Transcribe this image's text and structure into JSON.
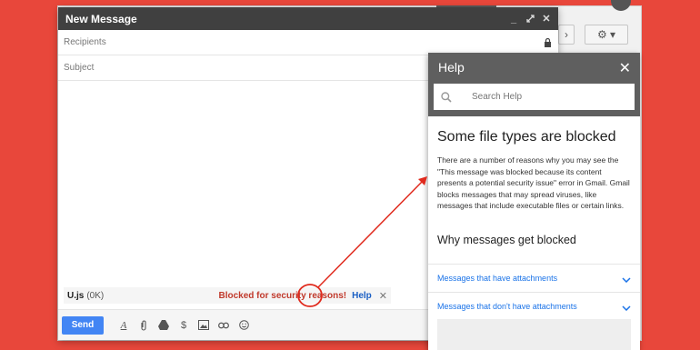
{
  "compose": {
    "title": "New Message",
    "recipients_placeholder": "Recipients",
    "subject_placeholder": "Subject",
    "attachment": {
      "name": "U.js",
      "size": "(0K)",
      "blocked_text": "Blocked for security reasons!",
      "help_link": "Help"
    },
    "send_label": "Send",
    "format_icon": "A"
  },
  "help": {
    "title": "Help",
    "search_placeholder": "Search Help",
    "article_title": "Some file types are blocked",
    "article_body": "There are a number of reasons why you may see the \"This message was blocked because its content presents a potential security issue\" error in Gmail. Gmail blocks messages that may spread viruses, like messages that include executable files or certain links.",
    "section_title": "Why messages get blocked",
    "accordion": [
      {
        "label": "Messages that have attachments"
      },
      {
        "label": "Messages that don't have attachments"
      }
    ]
  },
  "colors": {
    "background": "#e8473b",
    "link": "#1a73e8",
    "blocked": "#c0392b",
    "send": "#4285f4"
  }
}
